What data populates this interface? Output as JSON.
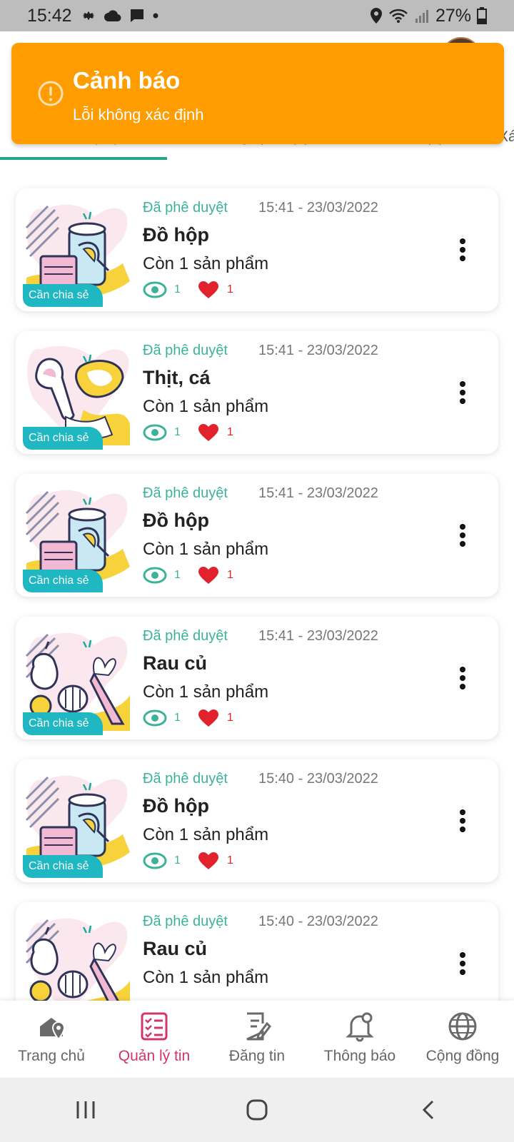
{
  "status_bar": {
    "time": "15:42",
    "battery": "27%",
    "left_icons": [
      "gear-icon",
      "cloud-icon",
      "message-icon",
      "dot-icon"
    ],
    "right_icons": [
      "location-icon",
      "wifi-icon",
      "signal-icon",
      "battery-icon"
    ]
  },
  "toast": {
    "title": "Cảnh báo",
    "message": "Lỗi không xác định",
    "icon": "warning-icon",
    "color": "#ff9c00"
  },
  "tabs": [
    {
      "label": "Tôi chia sẻ(10)",
      "active": true
    },
    {
      "label": "Tôi cần giúp đỡ(1)",
      "active": false
    },
    {
      "label": "Dự án(1)",
      "active": false
    },
    {
      "label": "Xá",
      "active": false
    }
  ],
  "posts": [
    {
      "status": "Đã phê duyệt",
      "time": "15:41 - 23/03/2022",
      "title": "Đồ hộp",
      "remain": "Còn 1 sản phẩm",
      "views": "1",
      "likes": "1",
      "badge": "Cần chia sẻ",
      "image": "canned-food"
    },
    {
      "status": "Đã phê duyệt",
      "time": "15:41 - 23/03/2022",
      "title": "Thịt, cá",
      "remain": "Còn 1 sản phẩm",
      "views": "1",
      "likes": "1",
      "badge": "Cần chia sẻ",
      "image": "meat-fish"
    },
    {
      "status": "Đã phê duyệt",
      "time": "15:41 - 23/03/2022",
      "title": "Đồ hộp",
      "remain": "Còn 1 sản phẩm",
      "views": "1",
      "likes": "1",
      "badge": "Cần chia sẻ",
      "image": "canned-food"
    },
    {
      "status": "Đã phê duyệt",
      "time": "15:41 - 23/03/2022",
      "title": "Rau củ",
      "remain": "Còn 1 sản phẩm",
      "views": "1",
      "likes": "1",
      "badge": "Cần chia sẻ",
      "image": "vegetables"
    },
    {
      "status": "Đã phê duyệt",
      "time": "15:40 - 23/03/2022",
      "title": "Đồ hộp",
      "remain": "Còn 1 sản phẩm",
      "views": "1",
      "likes": "1",
      "badge": "Cần chia sẻ",
      "image": "canned-food"
    },
    {
      "status": "Đã phê duyệt",
      "time": "15:40 - 23/03/2022",
      "title": "Rau củ",
      "remain": "Còn 1 sản phẩm",
      "views": "",
      "likes": "",
      "badge": "",
      "image": "vegetables"
    }
  ],
  "bottom_nav": [
    {
      "label": "Trang chủ",
      "icon": "home-location-icon",
      "active": false
    },
    {
      "label": "Quản lý tin",
      "icon": "checklist-icon",
      "active": true
    },
    {
      "label": "Đăng tin",
      "icon": "edit-document-icon",
      "active": false
    },
    {
      "label": "Thông báo",
      "icon": "bell-icon",
      "active": false
    },
    {
      "label": "Cộng đồng",
      "icon": "globe-icon",
      "active": false
    }
  ],
  "system_nav": [
    "recent-apps-icon",
    "home-icon",
    "back-icon"
  ],
  "colors": {
    "accent": "#22a889",
    "active_nav": "#d0356b",
    "badge": "#1fb7c2",
    "like": "#e0232d"
  }
}
